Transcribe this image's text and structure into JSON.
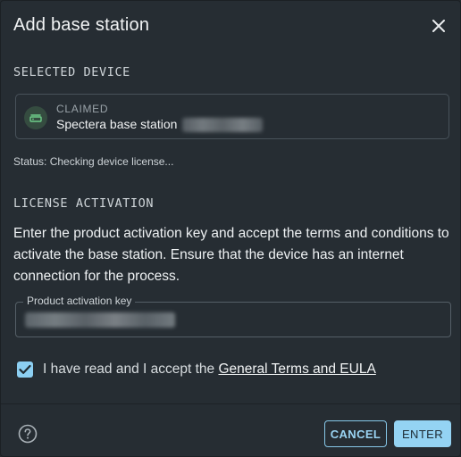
{
  "dialog": {
    "title": "Add base station",
    "close_icon": "close-icon"
  },
  "selected_device": {
    "section_label": "SELECTED DEVICE",
    "state": "CLAIMED",
    "name": "Spectera base station",
    "icon": "base-station-icon",
    "status": "Status: Checking device license..."
  },
  "license": {
    "section_label": "LICENSE ACTIVATION",
    "description": "Enter the product activation key and accept the terms and conditions to activate the base station. Ensure that the device has an internet connection for the process.",
    "field_label": "Product activation key",
    "accept_prefix": "I have read and I accept the ",
    "accept_link": "General Terms and EULA",
    "accepted": true
  },
  "footer": {
    "help_icon": "help-icon",
    "cancel_label": "CANCEL",
    "enter_label": "ENTER"
  },
  "colors": {
    "background": "#262d33",
    "accent": "#94d3f3",
    "device_icon_bg": "#354c40",
    "device_icon_fg": "#6ecf8a"
  }
}
